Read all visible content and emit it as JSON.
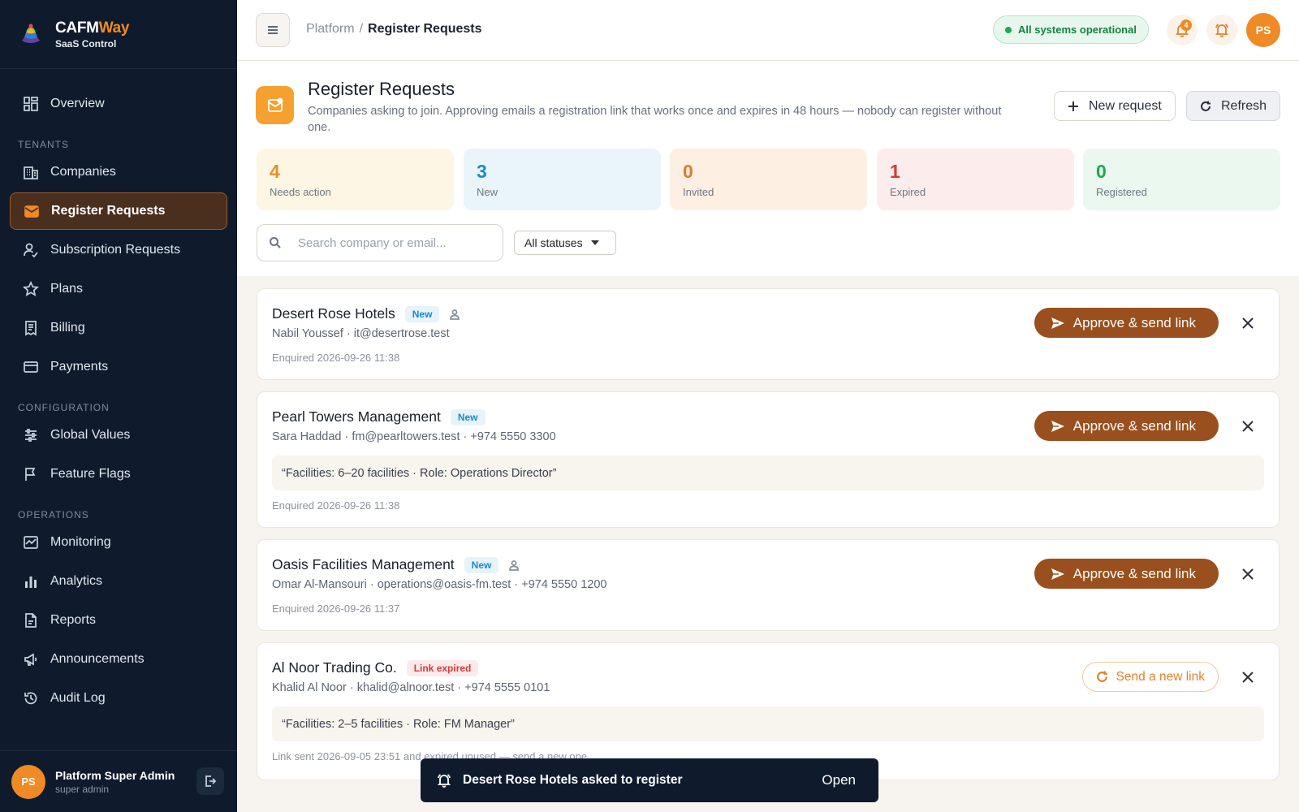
{
  "brand": {
    "name_primary": "CAFM",
    "name_accent": "Way",
    "subtitle": "SaaS Control"
  },
  "sidebar": {
    "overview": "Overview",
    "sections": {
      "tenants": "TENANTS",
      "configuration": "CONFIGURATION",
      "operations": "OPERATIONS"
    },
    "items": {
      "companies": "Companies",
      "register_requests": "Register Requests",
      "subscription_requests": "Subscription Requests",
      "plans": "Plans",
      "billing": "Billing",
      "payments": "Payments",
      "global_values": "Global Values",
      "feature_flags": "Feature Flags",
      "monitoring": "Monitoring",
      "analytics": "Analytics",
      "reports": "Reports",
      "announcements": "Announcements",
      "audit_log": "Audit Log"
    },
    "active_item": "register_requests",
    "user": {
      "initials": "PS",
      "name": "Platform Super Admin",
      "role": "super admin"
    }
  },
  "topbar": {
    "breadcrumb_root": "Platform",
    "breadcrumb_sep": "/",
    "breadcrumb_current": "Register Requests",
    "status": "All systems operational",
    "notification_count": "4",
    "avatar_initials": "PS"
  },
  "page": {
    "title": "Register Requests",
    "description": "Companies asking to join. Approving emails a registration link that works once and expires in 48 hours — nobody can register without one.",
    "new_request_label": "New request",
    "refresh_label": "Refresh"
  },
  "stats": [
    {
      "value": "4",
      "label": "Needs action",
      "color": "#e0922a",
      "bg": "#fdf6e4"
    },
    {
      "value": "3",
      "label": "New",
      "color": "#1b8ac5",
      "bg": "#eaf4fb"
    },
    {
      "value": "0",
      "label": "Invited",
      "color": "#e07a2a",
      "bg": "#fdf0e3"
    },
    {
      "value": "1",
      "label": "Expired",
      "color": "#d33a3a",
      "bg": "#fdecec"
    },
    {
      "value": "0",
      "label": "Registered",
      "color": "#1ea853",
      "bg": "#eaf8ef"
    }
  ],
  "filters": {
    "search_placeholder": "Search company or email...",
    "status_selected": "All statuses"
  },
  "requests": [
    {
      "company": "Desert Rose Hotels",
      "badge": "New",
      "contact": "Nabil Youssef · it@desertrose.test",
      "note": "",
      "meta": "Enquired 2026-09-26 11:38",
      "action": "Approve & send link"
    },
    {
      "company": "Pearl Towers Management",
      "badge": "New",
      "contact": "Sara Haddad · fm@pearltowers.test · +974 5550 3300",
      "note": "“Facilities: 6–20 facilities · Role: Operations Director”",
      "meta": "Enquired 2026-09-26 11:38",
      "action": "Approve & send link"
    },
    {
      "company": "Oasis Facilities Management",
      "badge": "New",
      "contact": "Omar Al-Mansouri · operations@oasis-fm.test · +974 5550 1200",
      "note": "",
      "meta": "Enquired 2026-09-26 11:37",
      "action": "Approve & send link"
    },
    {
      "company": "Al Noor Trading Co.",
      "badge": "Link expired",
      "contact": "Khalid Al Noor · khalid@alnoor.test · +974 5555 0101",
      "note": "“Facilities: 2–5 facilities · Role: FM Manager”",
      "meta": "Link sent 2026-09-05 23:51 and expired unused — send a new one.",
      "action": "Send a new link"
    }
  ],
  "toast": {
    "message": "Desert Rose Hotels asked to register",
    "action": "Open"
  },
  "colors": {
    "sidebar_bg": "#0f1b2d",
    "accent": "#f08a24",
    "approve_button": "#9a4f1e"
  }
}
